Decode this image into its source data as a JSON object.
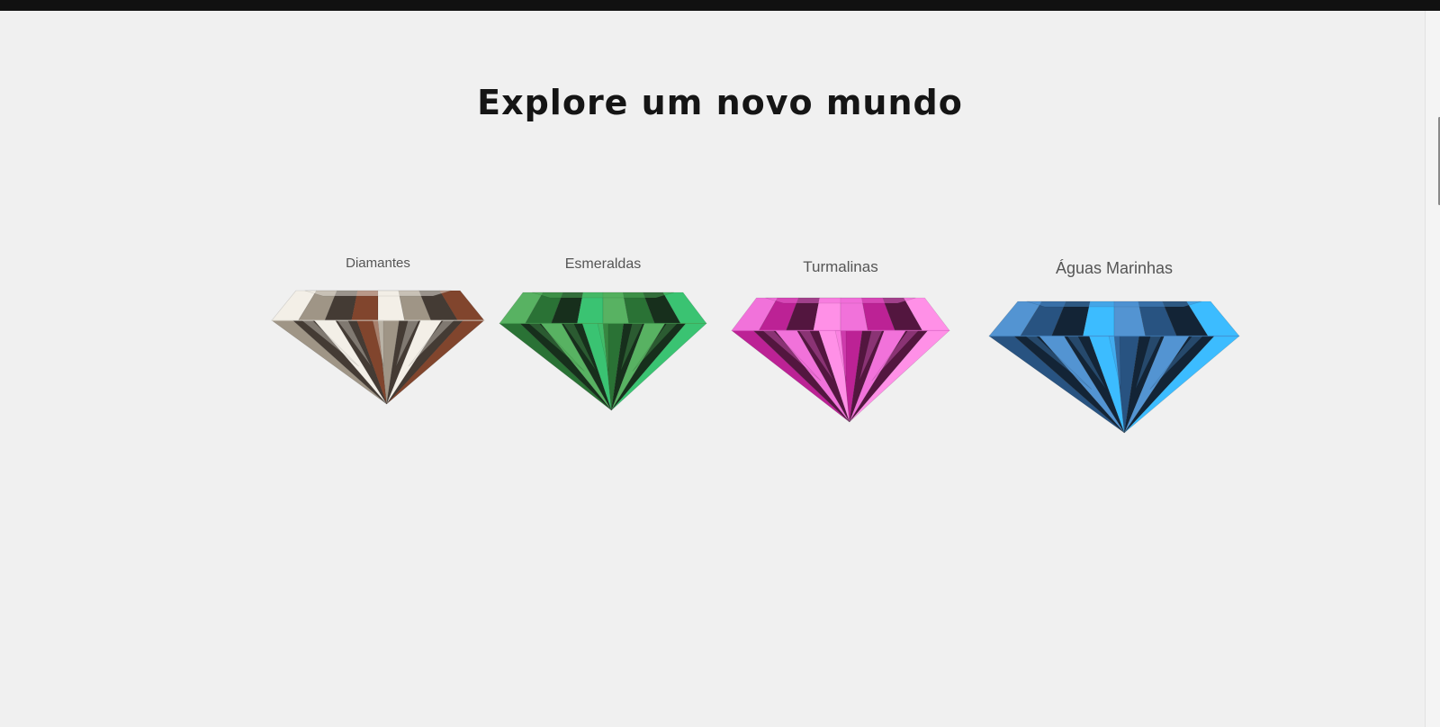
{
  "page": {
    "title": "Explore um novo mundo"
  },
  "gems": [
    {
      "label": "Diamantes",
      "icon": "diamond-gem-icon",
      "colors": {
        "light": "#f2eee6",
        "mid": "#9a8f80",
        "dark": "#3a3029",
        "accent": "#7a3b22"
      }
    },
    {
      "label": "Esmeraldas",
      "icon": "emerald-gem-icon",
      "colors": {
        "light": "#4fae5a",
        "mid": "#1f6a2a",
        "dark": "#0b2410",
        "accent": "#2fc06a"
      }
    },
    {
      "label": "Turmalinas",
      "icon": "tourmaline-gem-icon",
      "colors": {
        "light": "#f06ad8",
        "mid": "#b8168f",
        "dark": "#4a0a35",
        "accent": "#ff8ae6"
      }
    },
    {
      "label": "Águas Marinhas",
      "icon": "aquamarine-gem-icon",
      "colors": {
        "light": "#4a8ed0",
        "mid": "#1c4a7a",
        "dark": "#06182b",
        "accent": "#32b8ff"
      }
    }
  ]
}
